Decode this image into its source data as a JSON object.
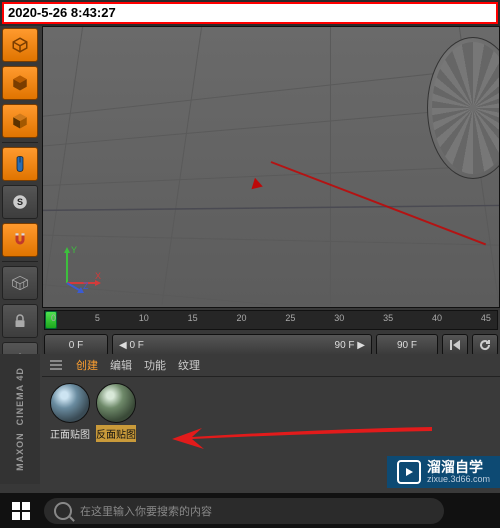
{
  "timestamp": "2020-5-26 8:43:27",
  "viewport": {
    "axis_x": "X",
    "axis_y": "Y",
    "axis_z": "Z"
  },
  "timeline": {
    "ticks": [
      "0",
      "5",
      "10",
      "15",
      "20",
      "25",
      "30",
      "35",
      "40",
      "45"
    ],
    "current_frame": "0 F",
    "range_start": "0 F",
    "range_end": "90 F",
    "end_frame": "90 F"
  },
  "material_menu": {
    "create": "创建",
    "edit": "编辑",
    "function": "功能",
    "texture": "纹理"
  },
  "materials": {
    "slot1_label": "正面贴图",
    "slot2_label": "反面贴图"
  },
  "branding": {
    "maxon": "MAXON",
    "product": "CINEMA 4D"
  },
  "watermark": {
    "title": "溜溜自学",
    "url": "zixue.3d66.com"
  },
  "taskbar": {
    "search_placeholder": "在这里输入你要搜索的内容"
  },
  "icons": {
    "model": "model-icon",
    "cube": "cube-icon",
    "poly": "poly-icon",
    "mouse": "mouse-icon",
    "snap": "snap-icon",
    "magnet": "magnet-icon",
    "grid": "grid-icon",
    "lock": "lock-icon",
    "cross": "cross-icon"
  }
}
